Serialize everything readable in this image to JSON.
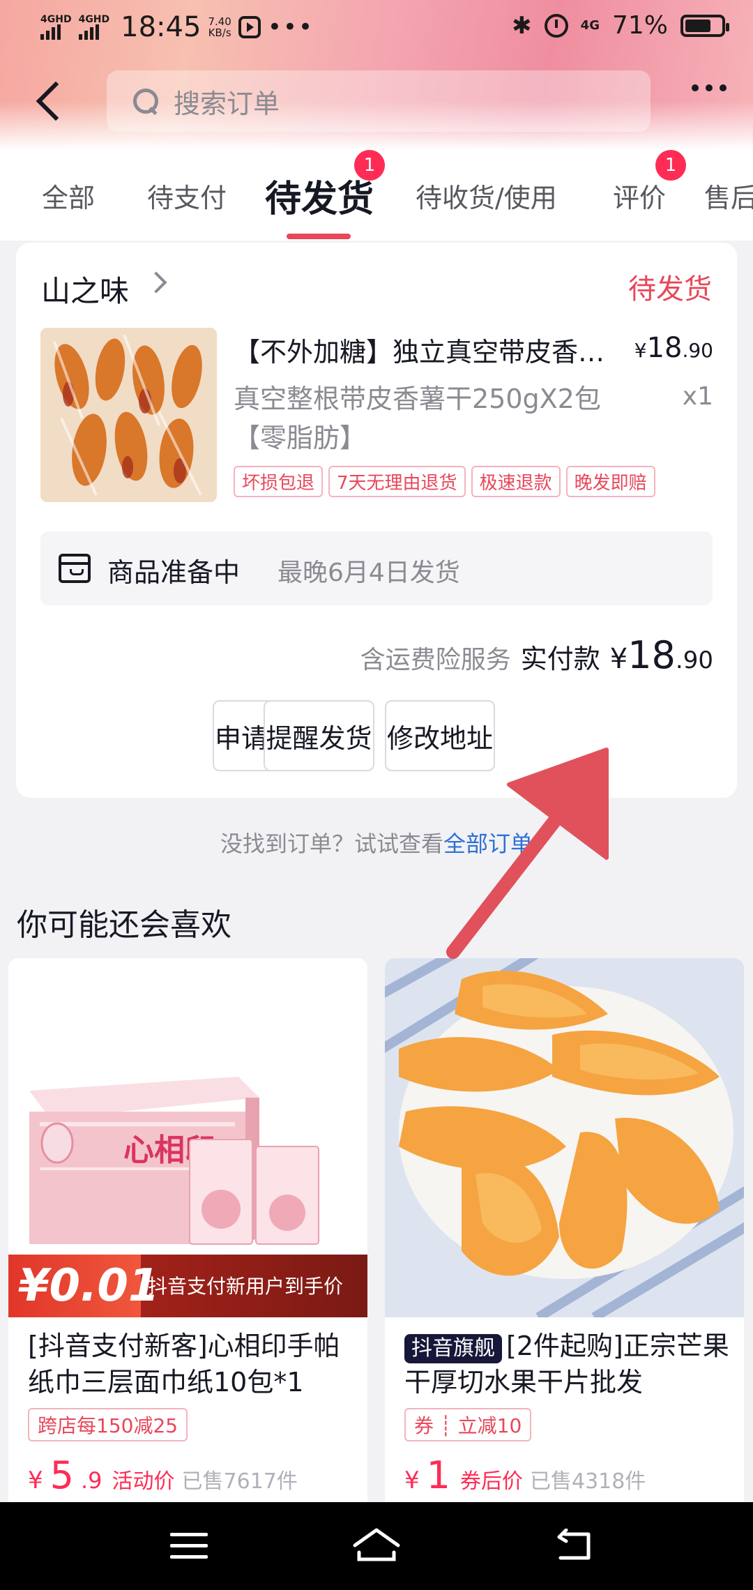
{
  "status_bar": {
    "signal1": "4GHD",
    "signal2": "4GHD",
    "time": "18:45",
    "net_speed_value": "7.40",
    "net_speed_unit": "KB/s",
    "bluetooth_icon": "bluetooth-icon",
    "network": "4G",
    "battery": "71%",
    "battery_level": 0.71
  },
  "header": {
    "search_placeholder": "搜索订单"
  },
  "tabs": [
    {
      "label": "全部"
    },
    {
      "label": "待支付"
    },
    {
      "label": "待发货",
      "badge": "1",
      "active": true
    },
    {
      "label": "待收货/使用"
    },
    {
      "label": "评价",
      "badge": "1"
    },
    {
      "label": "售后"
    }
  ],
  "order": {
    "shop": "山之味",
    "status": "待发货",
    "product_title": "【不外加糖】独立真空带皮香薯干",
    "price_int": "18",
    "price_dec": ".90",
    "currency": "¥",
    "spec": "真空整根带皮香薯干250gX2包【零脂肪】",
    "qty": "x1",
    "tags": [
      "坏损包退",
      "7天无理由退货",
      "极速退款",
      "晚发即赔"
    ],
    "ship_label": "商品准备中",
    "ship_date": "最晚6月4日发货",
    "total_note": "含运费险服务",
    "total_label": "实付款",
    "total_int": "18",
    "total_dec": ".90",
    "buttons": [
      "申请开票",
      "提醒发货",
      "修改地址"
    ]
  },
  "not_found": {
    "text": "没找到订单？试试查看",
    "link": "全部订单"
  },
  "recommend": {
    "title": "你可能还会喜欢",
    "items": [
      {
        "promo_price": "¥0.01",
        "promo_text": "抖音支付新用户到手价",
        "brand_text": "心相印",
        "name": "[抖音支付新客]心相印手帕纸巾三层面巾纸10包*1",
        "tag": "跨店每150减25",
        "price_int": "5",
        "price_dec": ".9",
        "price_label": "活动价",
        "sold": "已售7617件"
      },
      {
        "badge": "抖音旗舰",
        "name": "[2件起购]正宗芒果干厚切水果干片批发",
        "tag": "券 ┊ 立减10",
        "price_int": "1",
        "price_dec": "",
        "price_label": "券后价",
        "sold": "已售4318件"
      }
    ]
  },
  "colors": {
    "accent": "#fe2c55",
    "status_pink": "#e8475a",
    "link_blue": "#2e6fd6",
    "annotation_arrow": "#e0515c"
  }
}
